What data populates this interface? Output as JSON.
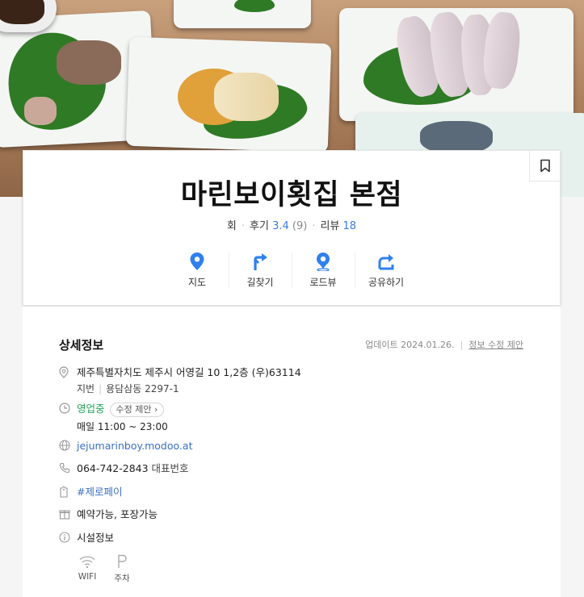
{
  "place": {
    "name": "마린보이횟집 본점",
    "category": "회",
    "review_label": "후기",
    "review_score": "3.4",
    "review_count": "(9)",
    "blog_label": "리뷰",
    "blog_count": "18"
  },
  "actions": [
    {
      "label": "지도",
      "icon": "map-pin-icon"
    },
    {
      "label": "길찾기",
      "icon": "directions-icon"
    },
    {
      "label": "로드뷰",
      "icon": "roadview-icon"
    },
    {
      "label": "공유하기",
      "icon": "share-icon"
    }
  ],
  "detail": {
    "title": "상세정보",
    "updated": "업데이트 2024.01.26.",
    "suggest_edit": "정보 수정 제안",
    "address": "제주특별자치도 제주시 어영길 10 1,2층 (우)63114",
    "lot_label": "지번",
    "lot_address": "용담삼동 2297-1",
    "status": "영업중",
    "status_edit": "수정 제안",
    "hours": "매일  11:00 ~ 23:00",
    "website": "jejumarinboy.modoo.at",
    "phone": "064-742-2843",
    "phone_type": "대표번호",
    "pay": "#제로페이",
    "services": "예약가능, 포장가능",
    "facility_title": "시설정보",
    "facilities": [
      {
        "label": "WIFI",
        "icon": "wifi-icon"
      },
      {
        "label": "주차",
        "icon": "parking-icon"
      }
    ]
  },
  "colors": {
    "accent_blue": "#3a7be0",
    "status_green": "#22a35a"
  }
}
